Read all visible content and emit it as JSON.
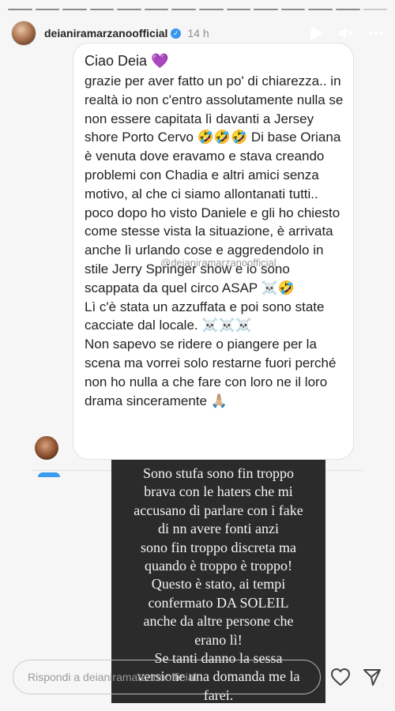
{
  "story": {
    "segments_total": 14,
    "segments_done": 13
  },
  "header": {
    "username": "deianiramarzanoofficial",
    "verified": true,
    "time_ago": "14 h",
    "icons": [
      "play-icon",
      "mute-icon",
      "more-icon"
    ]
  },
  "message": {
    "greeting": "Ciao Deia 💜",
    "body": "grazie per aver fatto un po' di chiarezza.. in realtà io non c'entro assolutamente nulla se non essere capitata lì davanti a Jersey shore Porto Cervo 🤣🤣🤣 Di base Oriana è venuta dove eravamo e stava creando problemi con Chadia e altri amici senza motivo, al che ci siamo allontanati tutti.. poco dopo ho visto Daniele e gli ho chiesto come stesse vista la situazione, è arrivata anche lì urlando cose e aggredendolo in stile Jerry Springer show e io sono scappata da quel circo ASAP ☠️🤣\nLì c'è stata un azzuffata e  poi sono state cacciate dal locale. ☠️☠️☠️\nNon sapevo se ridere o piangere per la scena ma vorrei solo restarne fuori perché non ho nulla a che fare con loro ne il loro drama sinceramente 🙏🏼",
    "watermark": "@deianiramarzanoofficial"
  },
  "note": {
    "text": "Sono stufa sono fin troppo\nbrava con le haters che mi\naccusano di parlare con i fake\ndi nn avere fonti anzi\nsono fin troppo discreta ma\nquando è troppo è troppo!\nQuesto è stato, ai tempi\nconfermato DA SOLEIL\nanche da altre persone che\nerano lì!\nSe tanti danno la sessa\nversione una domanda me la\nfarei."
  },
  "footer": {
    "reply_placeholder": "Rispondi a deianiramarzanoofficial...",
    "icons": [
      "heart-icon",
      "send-icon"
    ]
  },
  "colors": {
    "background": "#f6f6f7",
    "note_background": "#2b2b2b",
    "verified_blue": "#3897f0"
  }
}
